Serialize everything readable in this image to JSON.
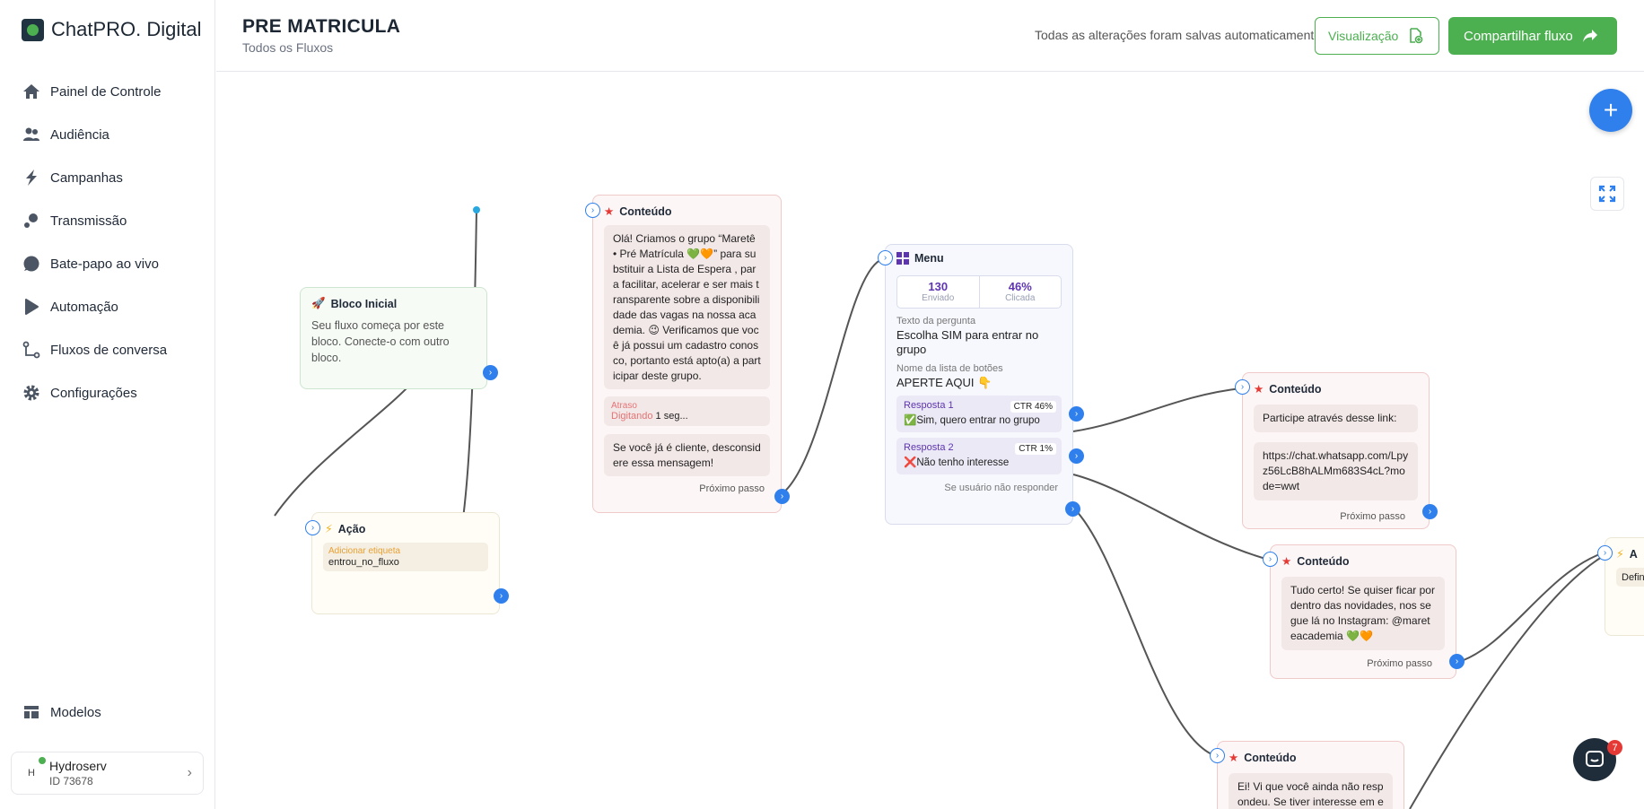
{
  "app": {
    "name": "ChatPRO. Digital"
  },
  "sidebar": {
    "items": [
      {
        "label": "Painel de Controle",
        "icon": "home-icon"
      },
      {
        "label": "Audiência",
        "icon": "users-icon"
      },
      {
        "label": "Campanhas",
        "icon": "bolt-icon"
      },
      {
        "label": "Transmissão",
        "icon": "broadcast-icon"
      },
      {
        "label": "Bate-papo ao vivo",
        "icon": "chat-bubble-icon"
      },
      {
        "label": "Automação",
        "icon": "play-icon"
      },
      {
        "label": "Fluxos de conversa",
        "icon": "flow-icon"
      },
      {
        "label": "Configurações",
        "icon": "gear-icon"
      }
    ],
    "bottom": {
      "label": "Modelos",
      "icon": "templates-icon"
    },
    "user": {
      "initial": "H",
      "name": "Hydroserv",
      "id": "ID 73678"
    }
  },
  "header": {
    "title": "PRE MATRICULA",
    "subtitle": "Todos os Fluxos",
    "saved_text": "Todas as alterações foram salvas automaticamente",
    "preview_label": "Visualização",
    "share_label": "Compartilhar fluxo"
  },
  "canvas": {
    "chat_badge": "7",
    "nodes": {
      "start": {
        "title": "Bloco Inicial",
        "desc": "Seu fluxo começa por este bloco. Conecte-o com outro bloco."
      },
      "acao": {
        "title": "Ação",
        "action_label": "Adicionar etiqueta",
        "action_value": "entrou_no_fluxo"
      },
      "cont1": {
        "title": "Conteúdo",
        "message": "Olá! Criamos o grupo “Maretê • Pré Matrícula 💚🧡” para substituir a Lista de Espera , para facilitar, acelerar e ser mais transparente sobre a disponibilidade das vagas na nossa academia. 😉 Verificamos que você já possui um cadastro conosco, portanto está apto(a) a participar deste grupo.",
        "delay_label": "Atraso",
        "delay_key": "Digitando",
        "delay_value": "1 seg...",
        "message2": "Se você já é cliente, desconsidere essa mensagem!",
        "next": "Próximo passo"
      },
      "menu": {
        "title": "Menu",
        "sent_value": "130",
        "sent_label": "Enviado",
        "click_value": "46%",
        "click_label": "Clicada",
        "question_label": "Texto da pergunta",
        "question_value": "Escolha SIM para entrar no grupo",
        "list_label": "Nome da lista de botões",
        "list_value": "APERTE AQUI 👇",
        "r1_title": "Resposta 1",
        "r1_ctr": "CTR 46%",
        "r1_value": "✅Sim, quero entrar no grupo",
        "r2_title": "Resposta 2",
        "r2_ctr": "CTR 1%",
        "r2_value": "❌Não tenho interesse",
        "noresp": "Se usuário não responder"
      },
      "cont2": {
        "title": "Conteúdo",
        "msg1": "Participe através desse link:",
        "msg2": "https://chat.whatsapp.com/Lpyz56LcB8hALMm683S4cL?mode=wwt",
        "next": "Próximo passo"
      },
      "cont3": {
        "title": "Conteúdo",
        "msg": "Tudo certo! Se quiser ficar por dentro das novidades, nos segue lá no Instagram: @mareteacademia 💚🧡",
        "next": "Próximo passo"
      },
      "cont4": {
        "title": "Conteúdo",
        "msg": "Ei! Vi que você ainda não respondeu. Se tiver interesse em e"
      },
      "cut": {
        "title": "A",
        "text": "Defin"
      }
    }
  },
  "colors": {
    "brand_green": "#4caf50",
    "accent_blue": "#2f80ed",
    "content_red": "#e53935",
    "menu_purple": "#5e35b1"
  }
}
